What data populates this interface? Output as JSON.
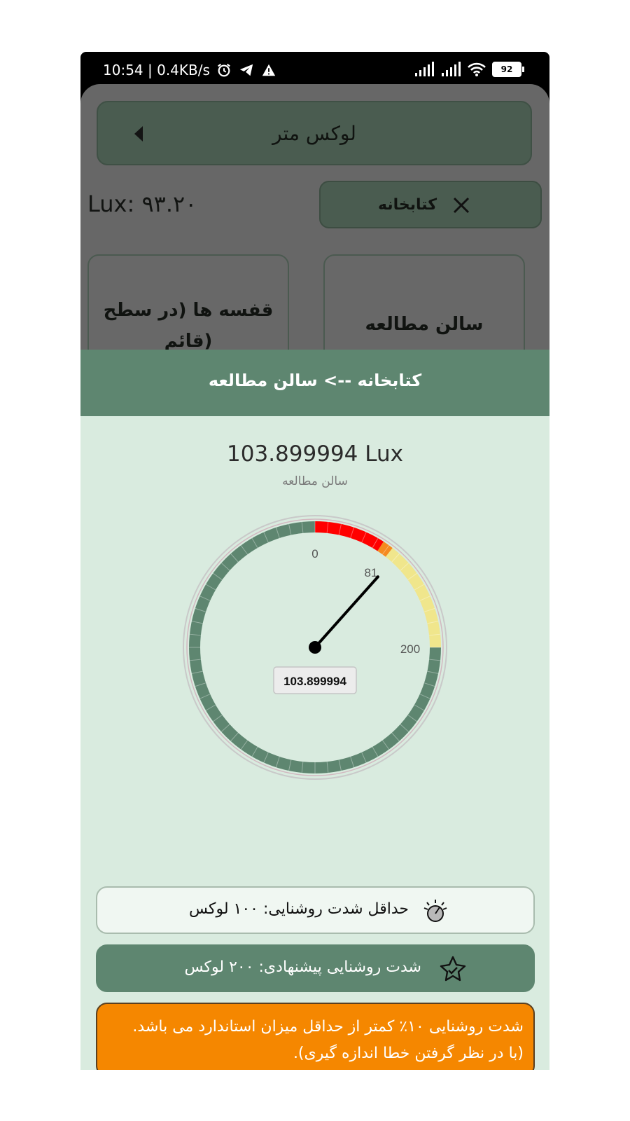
{
  "status_bar": {
    "time_speed": "10:54 | 0.4KB/s",
    "battery": "92"
  },
  "app": {
    "title": "لوکس متر",
    "lux_readout": "Lux: ۹۳.۲۰",
    "category_chip": "کتابخانه",
    "tiles": [
      {
        "label_line1": "قفسه ها (در سطح",
        "label_line2": "قائم)"
      },
      {
        "label": "سالن مطالعه"
      }
    ]
  },
  "sheet": {
    "title": "کتابخانه -->  سالن مطالعه",
    "measured_value": "103.899994 Lux",
    "location_label": "سالن مطالعه",
    "gauge": {
      "value": 103.899994,
      "value_label": "103.899994",
      "tick_labels": [
        "0",
        "81",
        "200"
      ],
      "colors": {
        "red": "#ff0000",
        "orange": "#f58a1f",
        "yellow": "#f0e68c",
        "green": "#5e8670"
      }
    },
    "min_row_text": "حداقل شدت روشنایی: ۱۰۰ لوکس",
    "rec_row_text": "شدت روشنایی پیشنهادی: ۲۰۰ لوکس",
    "warning_line1": "شدت روشنایی ۱۰٪ کمتر از حداقل میزان استاندارد می باشد.",
    "warning_line2": "(با در نظر گرفتن خطا اندازه گیری)."
  }
}
